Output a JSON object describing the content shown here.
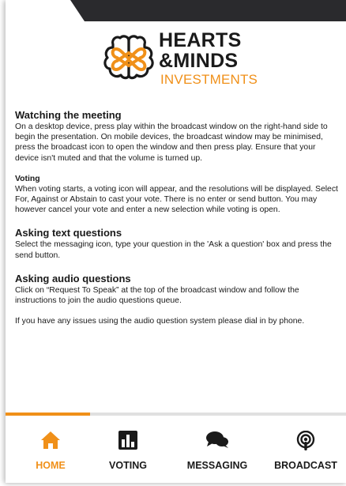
{
  "brand": {
    "line1": "HEARTS",
    "line2": "&MINDS",
    "line3": "INVESTMENTS",
    "accent": "#f09019",
    "dark": "#2a2a2d"
  },
  "sections": {
    "watching": {
      "title": "Watching the meeting",
      "body": "On a desktop device, press play within the broadcast window on the right-hand side to begin the presentation. On mobile devices, the broadcast window may be minimised, press the broadcast icon to open the window and then press play. Ensure that your device isn't muted and that the volume is turned up."
    },
    "voting": {
      "title": "Voting",
      "body": "When voting starts, a voting icon will appear, and the resolutions will be displayed. Select For, Against or Abstain to cast your vote. There is no enter or send button. You may however cancel your vote and enter a new selection while voting is open."
    },
    "text_questions": {
      "title": "Asking text questions",
      "body": "Select the messaging icon, type your question in the 'Ask a question' box and press the send button."
    },
    "audio_questions": {
      "title": "Asking audio questions",
      "body": "Click on “Request To Speak” at the top of the broadcast window and follow the instructions to join the audio questions queue.",
      "body2": "If you have any issues using the audio question system please dial in by phone."
    }
  },
  "tabs": {
    "home": {
      "label": "HOME",
      "icon": "home-icon",
      "active": true
    },
    "voting": {
      "label": "VOTING",
      "icon": "bar-chart-icon"
    },
    "messaging": {
      "label": "MESSAGING",
      "icon": "chat-bubbles-icon"
    },
    "broadcast": {
      "label": "BROADCAST",
      "icon": "podcast-icon"
    }
  }
}
